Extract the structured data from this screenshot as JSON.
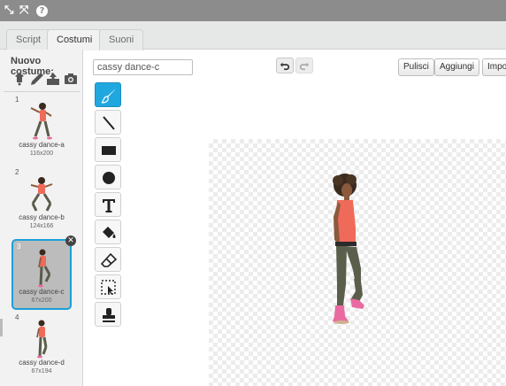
{
  "toolbar": {
    "icons": [
      "fullscreen-icon",
      "shrink-icon",
      "help-icon"
    ],
    "help_label": "?"
  },
  "tabs": [
    {
      "label": "Script",
      "active": false
    },
    {
      "label": "Costumi",
      "active": true
    },
    {
      "label": "Suoni",
      "active": false
    }
  ],
  "costume_panel": {
    "title": "Nuovo costume:",
    "new_icons": [
      "paint-from-library-icon",
      "paint-new-icon",
      "upload-icon",
      "camera-icon"
    ],
    "costumes": [
      {
        "number": "1",
        "name": "cassy dance-a",
        "size": "116x200",
        "selected": false
      },
      {
        "number": "2",
        "name": "cassy dance-b",
        "size": "124x166",
        "selected": false
      },
      {
        "number": "3",
        "name": "cassy dance-c",
        "size": "67x200",
        "selected": true
      },
      {
        "number": "4",
        "name": "cassy dance-d",
        "size": "67x194",
        "selected": false
      }
    ]
  },
  "editor": {
    "costume_name_value": "cassy dance-c",
    "buttons": {
      "clear": "Pulisci",
      "add": "Aggiungi",
      "import": "Impo"
    },
    "tools": [
      "brush-icon",
      "line-icon",
      "rectangle-icon",
      "ellipse-icon",
      "text-icon",
      "fill-icon",
      "eraser-icon",
      "select-icon",
      "stamp-icon"
    ],
    "active_tool": "brush-icon"
  },
  "colors": {
    "accent": "#21a7e0",
    "topbar": "#8c8c8c",
    "panel_bg": "#f2f2f2"
  }
}
